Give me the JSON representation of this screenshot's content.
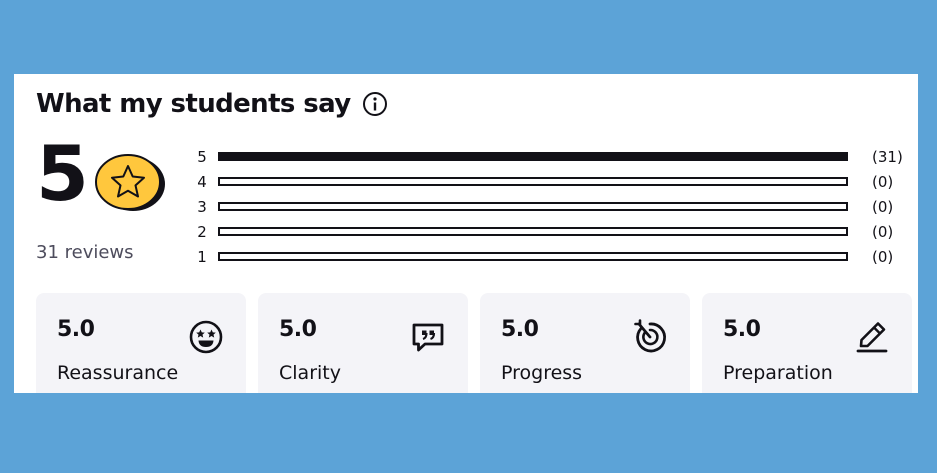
{
  "header": {
    "title": "What my students say",
    "info_icon": "info-circle-icon"
  },
  "summary": {
    "score": "5",
    "score_icon": "star-coin-icon",
    "reviews_text": "31 reviews"
  },
  "rating_breakdown": [
    {
      "stars": "5",
      "count_text": "(31)",
      "fraction": 1.0
    },
    {
      "stars": "4",
      "count_text": "(0)",
      "fraction": 0
    },
    {
      "stars": "3",
      "count_text": "(0)",
      "fraction": 0
    },
    {
      "stars": "2",
      "count_text": "(0)",
      "fraction": 0
    },
    {
      "stars": "1",
      "count_text": "(0)",
      "fraction": 0
    }
  ],
  "categories": [
    {
      "score": "5.0",
      "label": "Reassurance",
      "icon": "star-struck-face-icon"
    },
    {
      "score": "5.0",
      "label": "Clarity",
      "icon": "speech-bubble-quote-icon"
    },
    {
      "score": "5.0",
      "label": "Progress",
      "icon": "target-arrow-icon"
    },
    {
      "score": "5.0",
      "label": "Preparation",
      "icon": "pencil-icon"
    }
  ],
  "colors": {
    "background": "#5ca3d7",
    "card": "#ffffff",
    "text": "#121117",
    "muted_text": "#4d4c5c",
    "tile": "#f4f4f8",
    "coin": "#ffc73d"
  }
}
